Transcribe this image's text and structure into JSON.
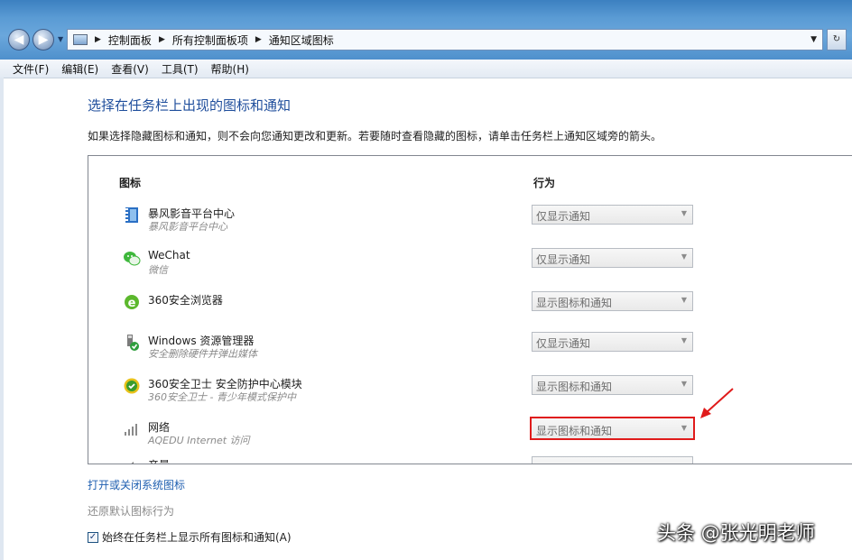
{
  "address_bar": {
    "crumbs": [
      "控制面板",
      "所有控制面板项",
      "通知区域图标"
    ]
  },
  "menu": [
    "文件(F)",
    "编辑(E)",
    "查看(V)",
    "工具(T)",
    "帮助(H)"
  ],
  "main": {
    "heading": "选择在任务栏上出现的图标和通知",
    "description": "如果选择隐藏图标和通知，则不会向您通知更改和更新。若要随时查看隐藏的图标，请单击任务栏上通知区域旁的箭头。",
    "columns": {
      "icon": "图标",
      "behavior": "行为"
    },
    "rows": [
      {
        "title": "暴风影音平台中心",
        "subtitle": "暴风影音平台中心",
        "behavior": "仅显示通知",
        "icon": "film-icon"
      },
      {
        "title": "WeChat",
        "subtitle": "微信",
        "behavior": "仅显示通知",
        "icon": "wechat-icon"
      },
      {
        "title": "360安全浏览器",
        "subtitle": "",
        "behavior": "显示图标和通知",
        "icon": "browser-icon"
      },
      {
        "title": "Windows 资源管理器",
        "subtitle": "安全删除硬件并弹出媒体",
        "behavior": "仅显示通知",
        "icon": "usb-icon"
      },
      {
        "title": "360安全卫士 安全防护中心模块",
        "subtitle": "360安全卫士 - 青少年模式保护中",
        "behavior": "显示图标和通知",
        "icon": "shield-icon"
      },
      {
        "title": "网络",
        "subtitle": "AQEDU Internet 访问",
        "behavior": "显示图标和通知",
        "icon": "network-icon"
      },
      {
        "title": "音量",
        "subtitle": "",
        "behavior": "",
        "icon": "volume-icon"
      }
    ],
    "system_icons_link": "打开或关闭系统图标",
    "restore_default": "还原默认图标行为",
    "always_show_label": "始终在任务栏上显示所有图标和通知(A)",
    "always_show_checked": true
  },
  "watermark": "头条 @张光明老师",
  "colors": {
    "heading": "#1f4e9c",
    "link": "#1f5fb0",
    "highlight": "#e01b1b"
  }
}
